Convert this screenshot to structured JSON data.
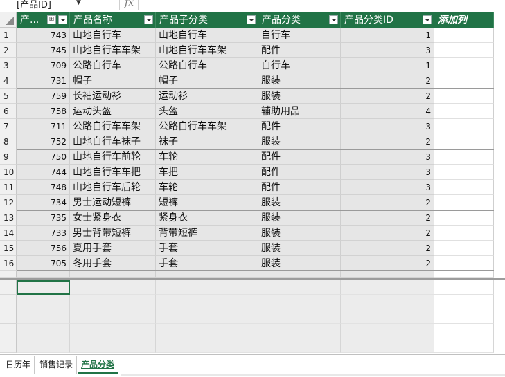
{
  "formula_bar": {
    "name_box": "[产品ID]",
    "fx_label": "fx"
  },
  "table": {
    "headers": [
      "产...",
      "产品名称",
      "产品子分类",
      "产品分类",
      "产品分类ID"
    ],
    "add_column_label": "添加列",
    "rows": [
      {
        "n": "1",
        "id": "743",
        "name": "山地自行车",
        "sub": "山地自行车",
        "cat": "自行车",
        "catid": "1"
      },
      {
        "n": "2",
        "id": "745",
        "name": "山地自行车车架",
        "sub": "山地自行车车架",
        "cat": "配件",
        "catid": "3"
      },
      {
        "n": "3",
        "id": "709",
        "name": "公路自行车",
        "sub": "公路自行车",
        "cat": "自行车",
        "catid": "1"
      },
      {
        "n": "4",
        "id": "731",
        "name": "帽子",
        "sub": "帽子",
        "cat": "服装",
        "catid": "2"
      },
      {
        "n": "5",
        "id": "759",
        "name": "长袖运动衫",
        "sub": "运动衫",
        "cat": "服装",
        "catid": "2"
      },
      {
        "n": "6",
        "id": "758",
        "name": "运动头盔",
        "sub": "头盔",
        "cat": "辅助用品",
        "catid": "4"
      },
      {
        "n": "7",
        "id": "711",
        "name": "公路自行车车架",
        "sub": "公路自行车车架",
        "cat": "配件",
        "catid": "3"
      },
      {
        "n": "8",
        "id": "752",
        "name": "山地自行车袜子",
        "sub": "袜子",
        "cat": "服装",
        "catid": "2"
      },
      {
        "n": "9",
        "id": "750",
        "name": "山地自行车前轮",
        "sub": "车轮",
        "cat": "配件",
        "catid": "3"
      },
      {
        "n": "10",
        "id": "744",
        "name": "山地自行车车把",
        "sub": "车把",
        "cat": "配件",
        "catid": "3"
      },
      {
        "n": "11",
        "id": "748",
        "name": "山地自行车后轮",
        "sub": "车轮",
        "cat": "配件",
        "catid": "3"
      },
      {
        "n": "12",
        "id": "734",
        "name": "男士运动短裤",
        "sub": "短裤",
        "cat": "服装",
        "catid": "2"
      },
      {
        "n": "13",
        "id": "735",
        "name": "女士紧身衣",
        "sub": "紧身衣",
        "cat": "服装",
        "catid": "2"
      },
      {
        "n": "14",
        "id": "733",
        "name": "男士背带短裤",
        "sub": "背带短裤",
        "cat": "服装",
        "catid": "2"
      },
      {
        "n": "15",
        "id": "756",
        "name": "夏用手套",
        "sub": "手套",
        "cat": "服装",
        "catid": "2"
      },
      {
        "n": "16",
        "id": "705",
        "name": "冬用手套",
        "sub": "手套",
        "cat": "服装",
        "catid": "2"
      }
    ]
  },
  "sheet_tabs": [
    "日历年",
    "销售记录",
    "产品分类"
  ],
  "active_tab": "产品分类",
  "colors": {
    "header_green": "#217346",
    "cell_gray": "#e6e6e6"
  }
}
